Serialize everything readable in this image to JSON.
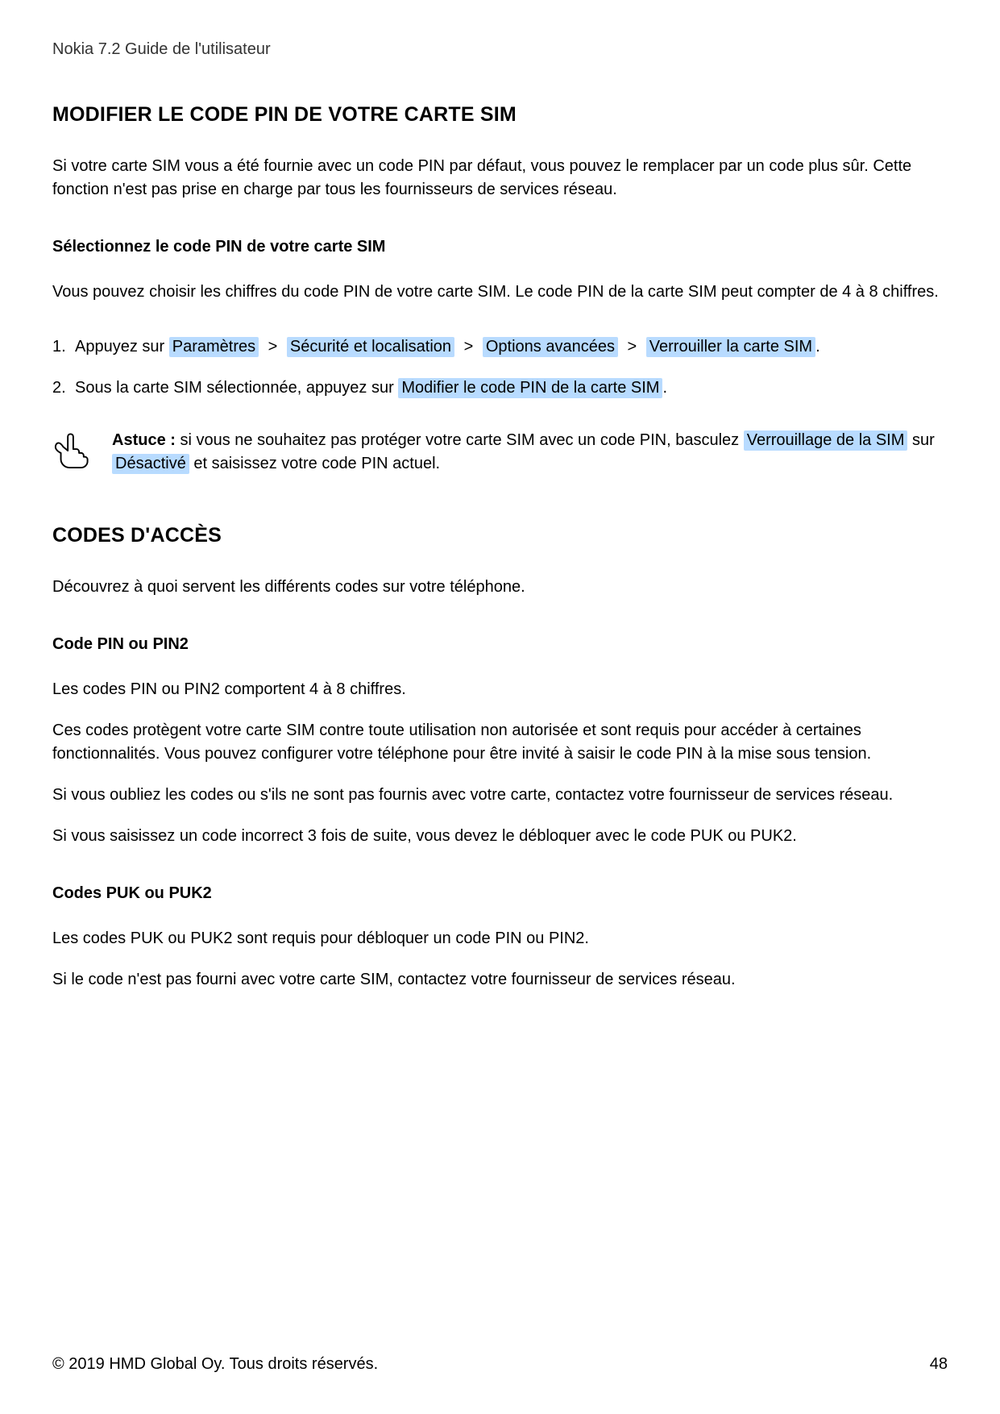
{
  "header": "Nokia 7.2 Guide de l'utilisateur",
  "section1": {
    "title": "MODIFIER LE CODE PIN DE VOTRE CARTE SIM",
    "intro": "Si votre carte SIM vous a été fournie avec un code PIN par défaut, vous pouvez le remplacer par un code plus sûr. Cette fonction n'est pas prise en charge par tous les fournisseurs de services réseau.",
    "sub_title": "Sélectionnez le code PIN de votre carte SIM",
    "sub_intro": "Vous pouvez choisir les chiffres du code PIN de votre carte SIM. Le code PIN de la carte SIM peut compter de 4 à 8 chiffres.",
    "step1": {
      "prefix": "Appuyez sur ",
      "p1": "Paramètres",
      "p2": "Sécurité et localisation",
      "p3": "Options avancées",
      "p4": "Verrouiller la carte SIM",
      "suffix": "."
    },
    "step2": {
      "prefix": "Sous la carte SIM sélectionnée, appuyez sur ",
      "p1": "Modifier le code PIN de la carte SIM",
      "suffix": "."
    },
    "tip": {
      "label": "Astuce : ",
      "t1": "si vous ne souhaitez pas protéger votre carte SIM avec un code PIN, basculez ",
      "p1": "Verrouillage de la SIM",
      "t2": " sur ",
      "p2": "Désactivé",
      "t3": " et saisissez votre code PIN actuel."
    }
  },
  "section2": {
    "title": "CODES D'ACCÈS",
    "intro": "Découvrez à quoi servent les différents codes sur votre téléphone.",
    "s1_title": "Code PIN ou PIN2",
    "s1_p1": "Les codes PIN ou PIN2 comportent 4 à 8 chiffres.",
    "s1_p2": "Ces codes protègent votre carte SIM contre toute utilisation non autorisée et sont requis pour accéder à certaines fonctionnalités. Vous pouvez configurer votre téléphone pour être invité à saisir le code PIN à la mise sous tension.",
    "s1_p3": "Si vous oubliez les codes ou s'ils ne sont pas fournis avec votre carte, contactez votre fournisseur de services réseau.",
    "s1_p4": "Si vous saisissez un code incorrect 3 fois de suite, vous devez le débloquer avec le code PUK ou PUK2.",
    "s2_title": "Codes PUK ou PUK2",
    "s2_p1": "Les codes PUK ou PUK2 sont requis pour débloquer un code PIN ou PIN2.",
    "s2_p2": "Si le code n'est pas fourni avec votre carte SIM, contactez votre fournisseur de services réseau."
  },
  "footer": {
    "copyright": "© 2019 HMD Global Oy. Tous droits réservés.",
    "page": "48"
  },
  "glyphs": {
    "chevron": ">"
  }
}
